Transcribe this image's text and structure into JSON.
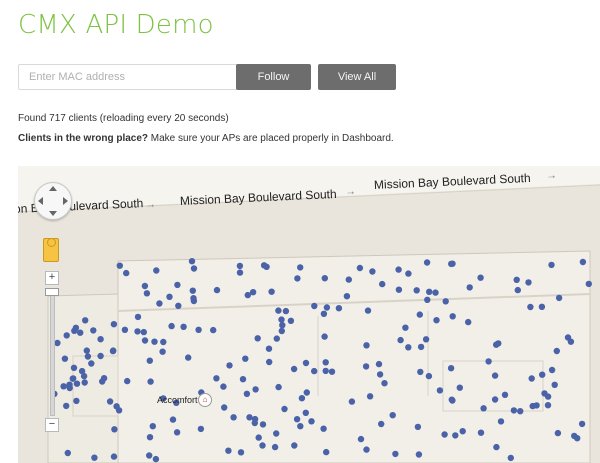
{
  "app": {
    "title": "CMX API Demo"
  },
  "search": {
    "placeholder": "Enter MAC address",
    "value": ""
  },
  "buttons": {
    "follow": "Follow",
    "view_all": "View All"
  },
  "status": {
    "text": "Found 717 clients (reloading every 20 seconds)"
  },
  "hint": {
    "bold": "Clients in the wrong place?",
    "rest": " Make sure your APs are placed properly in Dashboard."
  },
  "map": {
    "streets": [
      "on Bay Boulevard South",
      "Mission Bay Boulevard South",
      "Mission Bay Boulevard South"
    ],
    "arrow": "→",
    "poi": "Accomfort",
    "poi_icon": "hotel-icon",
    "zoom_in": "+",
    "zoom_out": "−",
    "dot_color": "#4a62a8",
    "building_color": "#f2efe8"
  }
}
